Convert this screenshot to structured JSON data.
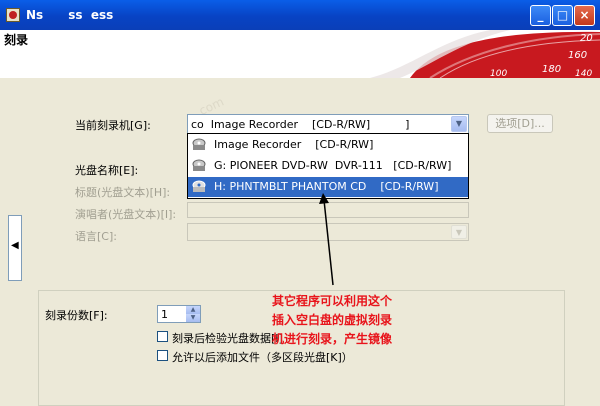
{
  "window": {
    "title": "Ns      ss  ess",
    "minimize_glyph": "_",
    "maximize_glyph": "□",
    "close_glyph": "×"
  },
  "banner": {
    "label": "刻录",
    "numbers": [
      "20",
      "160",
      "180",
      "140",
      "100"
    ],
    "watermark": ".com"
  },
  "form": {
    "recorder_label": "当前刻录机[G]:",
    "recorder_value": "co  Image Recorder    [CD-R/RW]          ]",
    "options_button": "选项[D]...",
    "disc_name_label": "光盘名称[E]:",
    "title_label": "标题(光盘文本)[H]:",
    "performer_label": "演唱者(光盘文本)[I]:",
    "language_label": "语言[C]:"
  },
  "dropdown": {
    "items": [
      {
        "label": "Image Recorder    [CD-R/RW]",
        "selected": false,
        "icon": "drive-icon"
      },
      {
        "label": "G: PIONEER DVD-RW  DVR-111   [CD-R/RW]",
        "selected": false,
        "icon": "drive-icon"
      },
      {
        "label": "H: PHNTMBLT PHANTOM CD    [CD-R/RW]",
        "selected": true,
        "icon": "drive-icon"
      }
    ],
    "partial_right_text": "W]"
  },
  "left_tab": {
    "glyph": "◀"
  },
  "copies": {
    "label": "刻录份数[F]:",
    "value": "1"
  },
  "checkboxes": [
    {
      "label": "刻录后检验光盘数据[I]",
      "checked": false
    },
    {
      "label": "允许以后添加文件（多区段光盘[K]）",
      "checked": false
    }
  ],
  "annotation": {
    "lines": [
      "其它程序可以利用这个",
      "插入空白盘的虚拟刻录",
      "机进行刻录，产生镜像"
    ]
  },
  "colors": {
    "titlebar": "#0a5ee8",
    "selection": "#316ac5",
    "annotation": "#e8141b",
    "banner_red": "#c8191f"
  }
}
